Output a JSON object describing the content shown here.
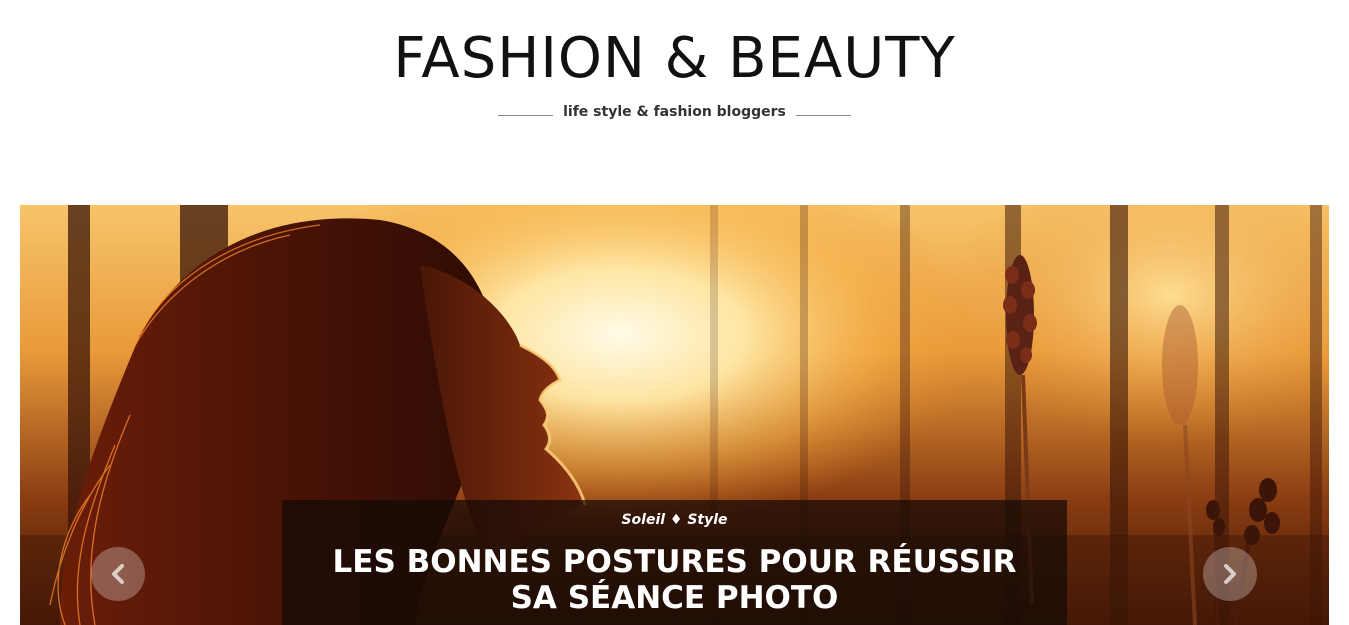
{
  "header": {
    "site_title": "FASHION & BEAUTY",
    "tagline": "life style & fashion bloggers"
  },
  "slider": {
    "current_slide": {
      "category": "Soleil ♦ Style",
      "title": "LES BONNES POSTURES POUR RÉUSSIR SA SÉANCE PHOTO",
      "image_subject": "woman silhouette with long hair at sunset behind railing and lavender stems"
    },
    "prev_icon": "chevron-left-icon",
    "next_icon": "chevron-right-icon"
  },
  "colors": {
    "title_text": "#111111",
    "tagline_text": "#333333",
    "caption_bg": "#140a06",
    "sunset_light": "#ffd27a",
    "sunset_orange": "#e0781e",
    "shadow_brown": "#3a1a08"
  }
}
